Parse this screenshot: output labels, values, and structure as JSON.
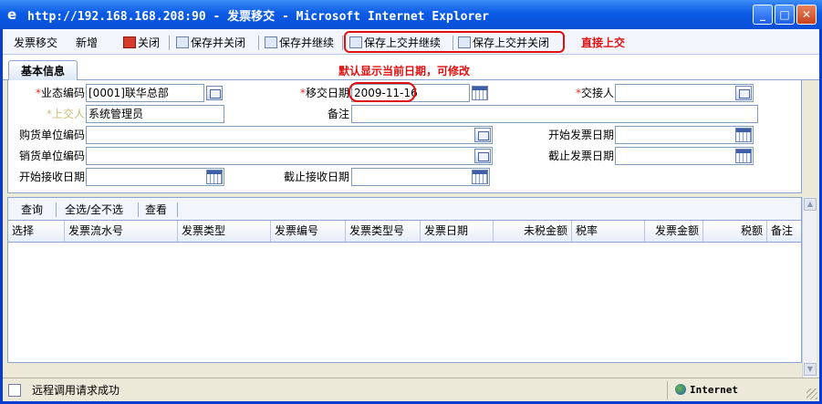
{
  "window": {
    "title": "http://192.168.168.208:90 - 发票移交 - Microsoft Internet Explorer"
  },
  "toolbar": {
    "module": "发票移交",
    "new": "新增",
    "close": "关闭",
    "save_close": "保存并关闭",
    "save_continue": "保存并继续",
    "save_submit_continue": "保存上交并继续",
    "save_submit_close": "保存上交并关闭"
  },
  "annotations": {
    "direct_submit": "直接上交",
    "default_date": "默认显示当前日期，可修改"
  },
  "tabs": {
    "basic": "基本信息"
  },
  "form": {
    "business_code": {
      "label": "业态编码",
      "value": "[0001]联华总部"
    },
    "transfer_date": {
      "label": "移交日期",
      "value": "2009-11-16"
    },
    "receiver": {
      "label": "交接人",
      "value": ""
    },
    "submitter": {
      "label": "上交人",
      "value": "系统管理员"
    },
    "remark": {
      "label": "备注",
      "value": ""
    },
    "buyer_code": {
      "label": "购货单位编码",
      "value": ""
    },
    "invoice_start": {
      "label": "开始发票日期",
      "value": ""
    },
    "seller_code": {
      "label": "销货单位编码",
      "value": ""
    },
    "invoice_end": {
      "label": "截止发票日期",
      "value": ""
    },
    "receive_start": {
      "label": "开始接收日期",
      "value": ""
    },
    "receive_end": {
      "label": "截止接收日期",
      "value": ""
    }
  },
  "grid": {
    "toolbar": {
      "query": "查询",
      "select_all": "全选/全不选",
      "view": "查看"
    },
    "columns": [
      "选择",
      "发票流水号",
      "发票类型",
      "发票编号",
      "发票类型号",
      "发票日期",
      "未税金额",
      "税率",
      "发票金额",
      "税额",
      "备注"
    ],
    "rows": []
  },
  "statusbar": {
    "message": "远程调用请求成功",
    "zone": "Internet"
  }
}
